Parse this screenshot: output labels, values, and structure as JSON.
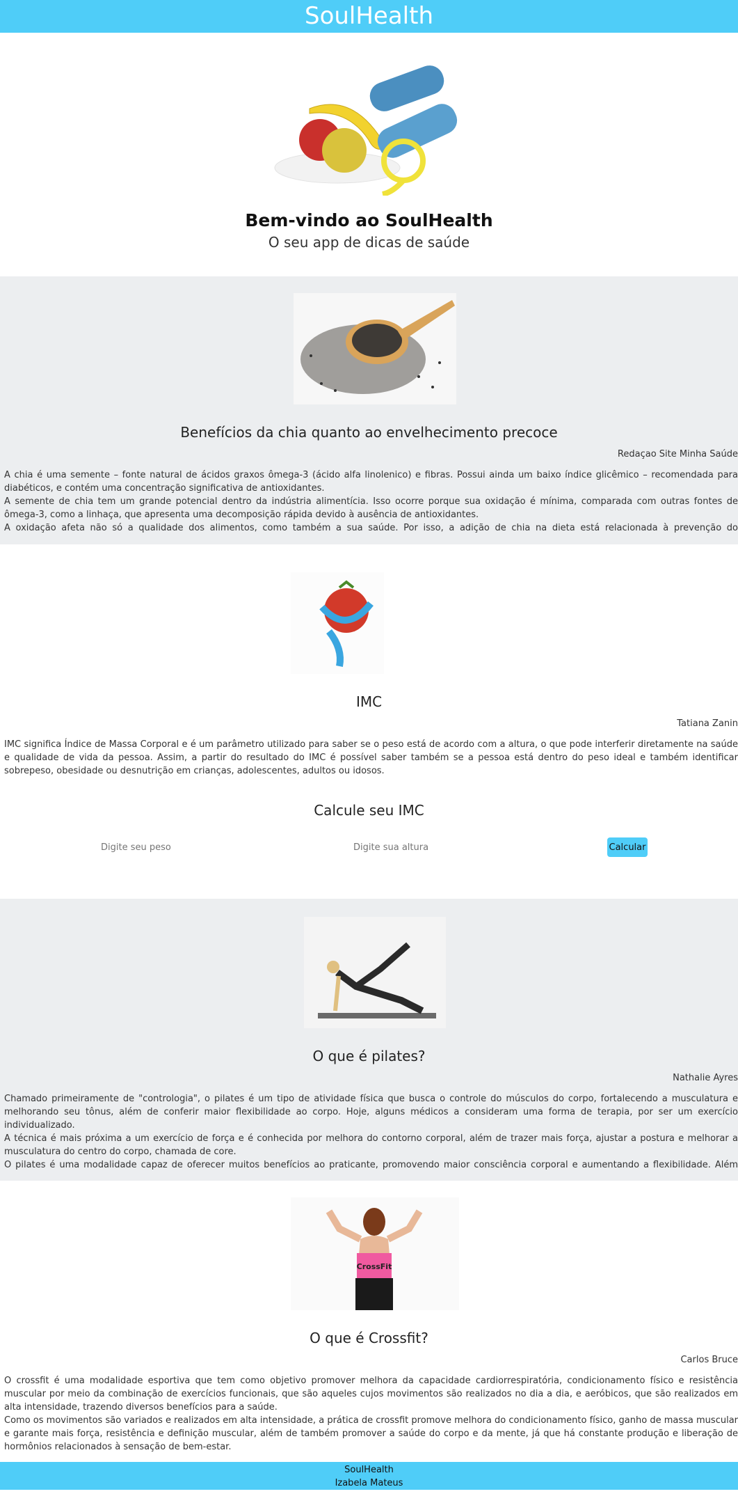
{
  "header": {
    "brand": "SoulHealth"
  },
  "hero": {
    "title": "Bem-vindo ao SoulHealth",
    "subtitle": "O seu app de dicas de saúde"
  },
  "chia": {
    "title": "Benefícios da chia quanto ao envelhecimento precoce",
    "author": "Redaçao Site Minha Saúde",
    "paragraphs": [
      "A chia é uma semente – fonte natural de ácidos graxos ômega-3 (ácido alfa linolenico) e fibras. Possui ainda um baixo índice glicêmico – recomendada para diabéticos, e contém uma concentração significativa de antioxidantes.",
      "A semente de chia tem um grande potencial dentro da indústria alimentícia. Isso ocorre porque sua oxidação é mínima, comparada com outras fontes de ômega-3, como a linhaça, que apresenta uma decomposição rápida devido à ausência de antioxidantes.",
      "A oxidação afeta não só a qualidade dos alimentos, como também a sua saúde. Por isso, a adição de chia na dieta está relacionada à prevenção do envelhecimento precoce."
    ]
  },
  "imc": {
    "title": "IMC",
    "author": "Tatiana Zanin",
    "paragraph": "IMC significa Índice de Massa Corporal e é um parâmetro utilizado para saber se o peso está de acordo com a altura, o que pode interferir diretamente na saúde e qualidade de vida da pessoa. Assim, a partir do resultado do IMC é possível saber também se a pessoa está dentro do peso ideal e também identificar sobrepeso, obesidade ou desnutrição em crianças, adolescentes, adultos ou idosos.",
    "calc_title": "Calcule seu IMC",
    "weight_placeholder": "Digite seu peso",
    "height_placeholder": "Digite sua altura",
    "button_label": "Calcular"
  },
  "pilates": {
    "title": "O que é pilates?",
    "author": "Nathalie Ayres",
    "paragraphs": [
      "Chamado primeiramente de \"contrologia\", o pilates é um tipo de atividade física que busca o controle do músculos do corpo, fortalecendo a musculatura e melhorando seu tônus, além de conferir maior flexibilidade ao corpo. Hoje, alguns médicos a consideram uma forma de terapia, por ser um exercício individualizado.",
      "A técnica é mais próxima a um exercício de força e é conhecida por melhora do contorno corporal, além de trazer mais força, ajustar a postura e melhorar a musculatura do centro do corpo, chamada de core.",
      "O pilates é uma modalidade capaz de oferecer muitos benefícios ao praticante, promovendo maior consciência corporal e aumentando a flexibilidade. Além disso, sua prática pode ajudar a aumentar o prazer durante as relações sexuais."
    ]
  },
  "crossfit": {
    "title": "O que é Crossfit?",
    "author": "Carlos Bruce",
    "shirt_text": "CrossFit",
    "paragraphs": [
      "O crossfit é uma modalidade esportiva que tem como objetivo promover melhora da capacidade cardiorrespiratória, condicionamento físico e resistência muscular por meio da combinação de exercícios funcionais, que são aqueles cujos movimentos são realizados no dia a dia, e aeróbicos, que são realizados em alta intensidade, trazendo diversos benefícios para a saúde.",
      "Como os movimentos são variados e realizados em alta intensidade, a prática de crossfit promove melhora do condicionamento físico, ganho de massa muscular e garante mais força, resistência e definição muscular, além de também promover a saúde do corpo e da mente, já que há constante produção e liberação de hormônios relacionados à sensação de bem-estar."
    ]
  },
  "footer": {
    "brand": "SoulHealth",
    "author": "Izabela Mateus"
  },
  "colors": {
    "accent": "#4fcdf8",
    "section_gray": "#eceef0"
  }
}
